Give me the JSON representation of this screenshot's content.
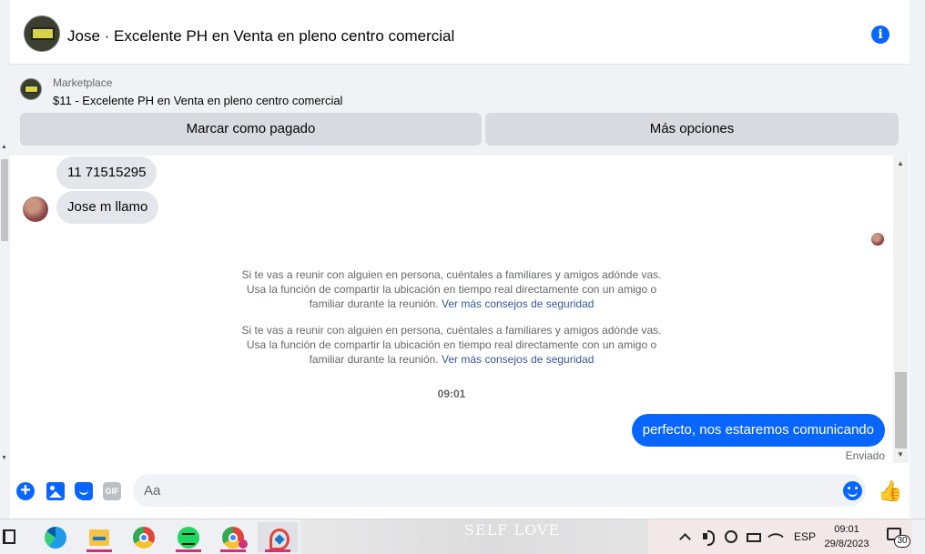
{
  "header": {
    "contact_title": "Jose · Excelente PH en Venta en pleno centro comercial"
  },
  "marketplace": {
    "label": "Marketplace",
    "item": "$11 - Excelente PH en Venta en pleno centro comercial",
    "mark_paid_label": "Marcar como pagado",
    "more_options_label": "Más opciones"
  },
  "messages": {
    "incoming": [
      {
        "text": "11 71515295"
      },
      {
        "text": "Jose m llamo"
      }
    ],
    "safety_notices": [
      {
        "line1": "Si te vas a reunir con alguien en persona, cuéntales a familiares y amigos adónde vas.",
        "line2": "Usa la función de compartir la ubicación en tiempo real directamente con un amigo o",
        "line3": "familiar durante la reunión.",
        "link": "Ver más consejos de seguridad"
      },
      {
        "line1": "Si te vas a reunir con alguien en persona, cuéntales a familiares y amigos adónde vas.",
        "line2": "Usa la función de compartir la ubicación en tiempo real directamente con un amigo o",
        "line3": "familiar durante la reunión.",
        "link": "Ver más consejos de seguridad"
      }
    ],
    "time_separator": "09:01",
    "outgoing": {
      "text": "perfecto, nos estaremos comunicando"
    },
    "status": "Enviado"
  },
  "composer": {
    "placeholder": "Aa",
    "gif_label": "GIF"
  },
  "colors": {
    "accent": "#0866ff",
    "incoming_bubble": "#e4e6eb",
    "secondary_text": "#65676b"
  },
  "taskbar": {
    "wallpaper_text": "SELF LOVE",
    "language": "ESP",
    "time": "09:01",
    "date": "29/8/2023",
    "notification_count": "30"
  }
}
